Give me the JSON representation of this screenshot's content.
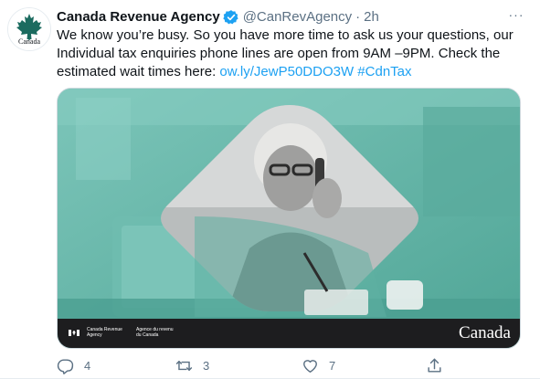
{
  "tweet": {
    "author_name": "Canada Revenue Agency",
    "author_handle": "@CanRevAgency",
    "separator": "·",
    "time": "2h",
    "avatar_text": "Canada",
    "more_label": "···",
    "text": "We know you’re busy. So you have more time to ask us your questions, our Individual tax enquiries phone lines are open from 9AM –9PM. Check the estimated wait times here: ",
    "link": "ow.ly/JewP50DDO3W",
    "hashtag": "#CdnTax",
    "media": {
      "agency_en": "Canada Revenue Agency",
      "agency_fr": "Agence du revenu du Canada",
      "wordmark": "Canada",
      "tint_color": "#62b4a7"
    },
    "actions": {
      "reply_count": "4",
      "retweet_count": "3",
      "like_count": "7"
    }
  },
  "colors": {
    "link": "#1da1f2",
    "secondary_text": "#5b7083",
    "maple_red": "#c8102e",
    "verified": "#1da1f2"
  },
  "icons": [
    "maple-leaf-icon",
    "verified-badge-icon",
    "more-icon",
    "reply-icon",
    "retweet-icon",
    "like-icon",
    "share-icon"
  ]
}
